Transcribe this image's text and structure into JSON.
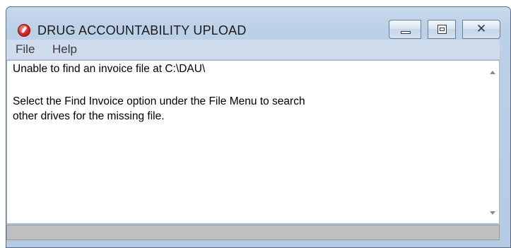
{
  "window": {
    "title": "DRUG ACCOUNTABILITY UPLOAD",
    "icon": "app-logo-icon",
    "controls": {
      "minimize": "minimize-icon",
      "maximize": "maximize-icon",
      "close_glyph": "✕"
    }
  },
  "menu": {
    "items": [
      {
        "label": "File"
      },
      {
        "label": "Help"
      }
    ]
  },
  "content": {
    "lines": [
      "Unable to find an invoice file at C:\\DAU\\",
      "",
      "Select the Find Invoice option under the File Menu to search",
      "other drives for the missing file."
    ]
  },
  "colors": {
    "titlebar": "#bcd0e7",
    "menubar": "#cfdced",
    "statusbar": "#bfbfbf"
  }
}
